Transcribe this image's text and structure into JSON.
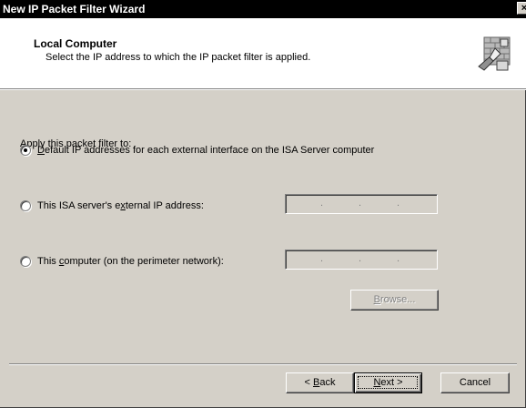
{
  "window": {
    "title": "New IP Packet Filter Wizard",
    "close_glyph": "×"
  },
  "header": {
    "title": "Local Computer",
    "subtitle": "Select the IP address to which the IP packet filter is applied.",
    "icon": "wizard-firewall-icon"
  },
  "form": {
    "prompt": "Apply this packet filter to:",
    "options": [
      {
        "accel": "D",
        "rest": "efault IP addresses for each external interface on the ISA Server computer",
        "checked": true
      },
      {
        "pre": "This ISA server's e",
        "accel": "x",
        "rest": "ternal IP address:",
        "checked": false
      },
      {
        "pre": "This ",
        "accel": "c",
        "rest": "omputer (on the perimeter network):",
        "checked": false
      }
    ],
    "ip_separator": ".",
    "browse": {
      "accel": "B",
      "rest": "rowse...",
      "enabled": false
    }
  },
  "footer": {
    "back": {
      "pre": "< ",
      "accel": "B",
      "rest": "ack"
    },
    "next": {
      "accel": "N",
      "rest": "ext >"
    },
    "cancel": "Cancel"
  },
  "colors": {
    "face": "#d4d0c8",
    "title_bar": "#000000",
    "header_bg": "#ffffff"
  }
}
